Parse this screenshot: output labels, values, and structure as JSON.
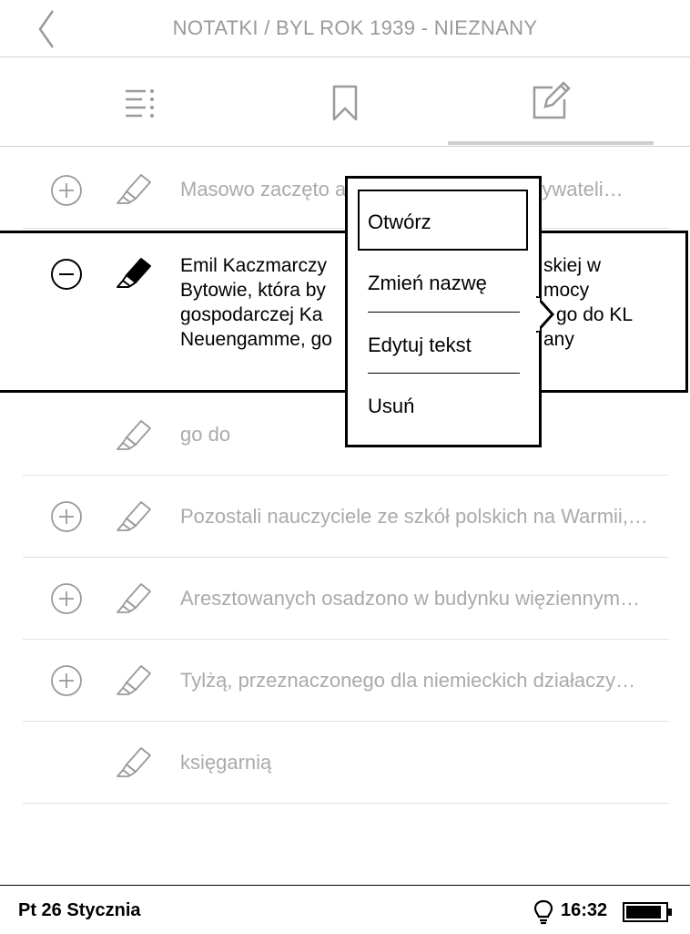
{
  "header": {
    "title": "NOTATKI / BYL ROK 1939 - NIEZNANY",
    "back_icon": "chevron-left-icon"
  },
  "tabs": [
    {
      "name": "toc",
      "icon": "list-icon",
      "active": false
    },
    {
      "name": "bookmarks",
      "icon": "bookmark-icon",
      "active": false
    },
    {
      "name": "notes",
      "icon": "edit-note-icon",
      "active": true
    }
  ],
  "notes": [
    {
      "text": "Masowo zaczęto aresztować polskich obywateli…",
      "expand": "plus"
    },
    {
      "lines": [
        "Emil Kaczmarczyk, kierownik szkoły polskiej w",
        "Bytowie, która była przedmiotem pomocy",
        "gospodarczej Kasy Szkolnej, wysłano go do KL",
        "Neuengamme, gdzie został zamordowany"
      ],
      "expand": "minus",
      "selected": true
    },
    {
      "text": "go do",
      "expand": "none"
    },
    {
      "text": "Pozostali nauczyciele ze szkół polskich na Warmii,…",
      "expand": "plus"
    },
    {
      "text": "Aresztowanych osadzono w budynku więziennym…",
      "expand": "plus"
    },
    {
      "text": "Tylżą, przeznaczonego dla niemieckich działaczy…",
      "expand": "plus"
    },
    {
      "text": "księgarnią",
      "expand": "none"
    }
  ],
  "selected_visible": [
    "Emil Kaczmarczy",
    "Bytowie, która by",
    "gospodarczej Ka",
    "Neuengamme, go",
    "skiej w",
    "mocy",
    "go do KL",
    "any"
  ],
  "popup": {
    "items": [
      "Otwórz",
      "Zmień nazwę",
      "Edytuj tekst",
      "Usuń"
    ],
    "focused": 0
  },
  "status": {
    "date": "Pt 26 Stycznia",
    "time": "16:32",
    "battery_level": 0.9,
    "light_icon": "bulb-icon",
    "battery_icon": "battery-icon"
  }
}
